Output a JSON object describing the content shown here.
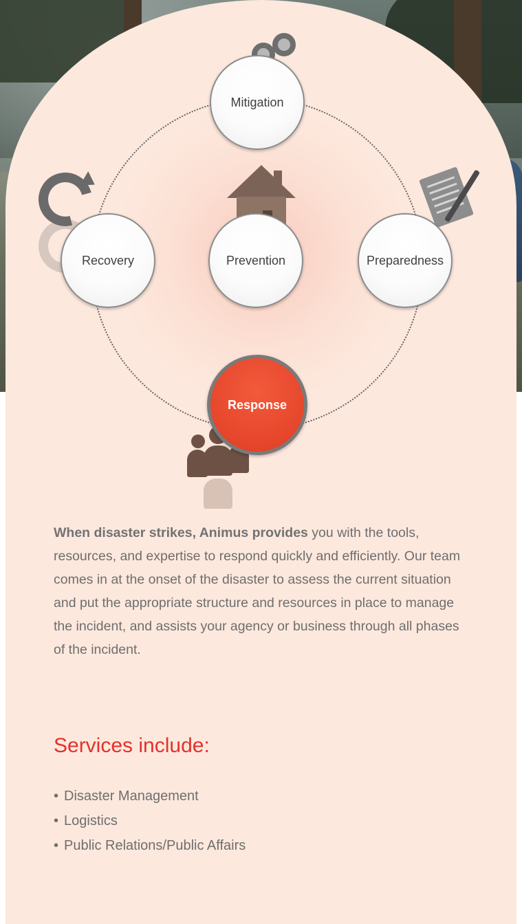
{
  "cycle": {
    "nodes": {
      "mitigation": "Mitigation",
      "recovery": "Recovery",
      "prevention": "Prevention",
      "preparedness": "Preparedness",
      "response": "Response"
    },
    "active": "response",
    "icons": {
      "mitigation": "binoculars-icon",
      "recovery": "cycle-arrows-icon",
      "prevention": "house-icon",
      "preparedness": "document-pen-icon",
      "response": "people-group-icon"
    },
    "colors": {
      "active_fill": "#e6462b",
      "panel": "#fde8dd"
    }
  },
  "intro": {
    "lead": "When disaster strikes, Animus provides",
    "body": " you with the tools, resources, and expertise to respond quickly and efficiently. Our team comes in at the onset of the disaster to assess the current situation and put the appropriate structure and resources in place to manage the incident, and assists your agency or business through all phases of the incident."
  },
  "services": {
    "title": "Services include:",
    "items": [
      "Disaster Management",
      "Logistics",
      "Public Relations/Public Affairs"
    ],
    "title_color": "#e4312b"
  }
}
